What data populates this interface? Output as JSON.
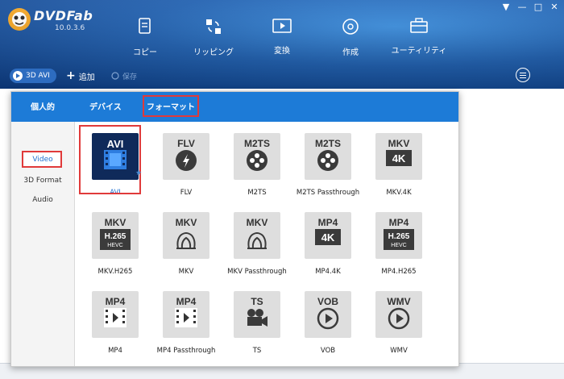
{
  "app": {
    "name": "DVDFab",
    "version": "10.0.3.6"
  },
  "window_controls": [
    "▼",
    "—",
    "□",
    "✕"
  ],
  "nav": [
    {
      "label": "コピー",
      "icon": "copy-icon"
    },
    {
      "label": "リッピング",
      "icon": "ripper-icon"
    },
    {
      "label": "変換",
      "icon": "converter-icon"
    },
    {
      "label": "作成",
      "icon": "creator-icon"
    },
    {
      "label": "ユーティリティ",
      "icon": "toolbox-icon"
    }
  ],
  "subbar": {
    "mode": "3D AVI",
    "add": "追加",
    "save": "保存"
  },
  "popup": {
    "tabs": [
      "個人的",
      "デバイス",
      "フォーマット"
    ],
    "active_tab": "フォーマット",
    "sidebar": [
      "Video",
      "3D Format",
      "Audio"
    ],
    "active_sidebar": "Video",
    "formats": [
      {
        "tile": "AVI",
        "caption": "AVI",
        "glyph": "film",
        "selected": true
      },
      {
        "tile": "FLV",
        "caption": "FLV",
        "glyph": "flash"
      },
      {
        "tile": "M2TS",
        "caption": "M2TS",
        "glyph": "reel"
      },
      {
        "tile": "M2TS",
        "caption": "M2TS Passthrough",
        "glyph": "reel"
      },
      {
        "tile": "MKV",
        "caption": "MKV.4K",
        "glyph": "4K"
      },
      {
        "tile": "MKV",
        "caption": "MKV.H265",
        "glyph": "H.265",
        "sub": "HEVC"
      },
      {
        "tile": "MKV",
        "caption": "MKV",
        "glyph": "matroska"
      },
      {
        "tile": "MKV",
        "caption": "MKV Passthrough",
        "glyph": "matroska"
      },
      {
        "tile": "MP4",
        "caption": "MP4.4K",
        "glyph": "4K"
      },
      {
        "tile": "MP4",
        "caption": "MP4.H265",
        "glyph": "H.265",
        "sub": "HEVC"
      },
      {
        "tile": "MP4",
        "caption": "MP4",
        "glyph": "film"
      },
      {
        "tile": "MP4",
        "caption": "MP4 Passthrough",
        "glyph": "film"
      },
      {
        "tile": "TS",
        "caption": "TS",
        "glyph": "camera"
      },
      {
        "tile": "VOB",
        "caption": "VOB",
        "glyph": "play"
      },
      {
        "tile": "WMV",
        "caption": "WMV",
        "glyph": "play"
      }
    ]
  },
  "colors": {
    "header": "#1e5fb0",
    "popup_tabbar": "#1d7bd7",
    "highlight": "#e03a3a",
    "selected_tile": "#0f2a5a"
  }
}
